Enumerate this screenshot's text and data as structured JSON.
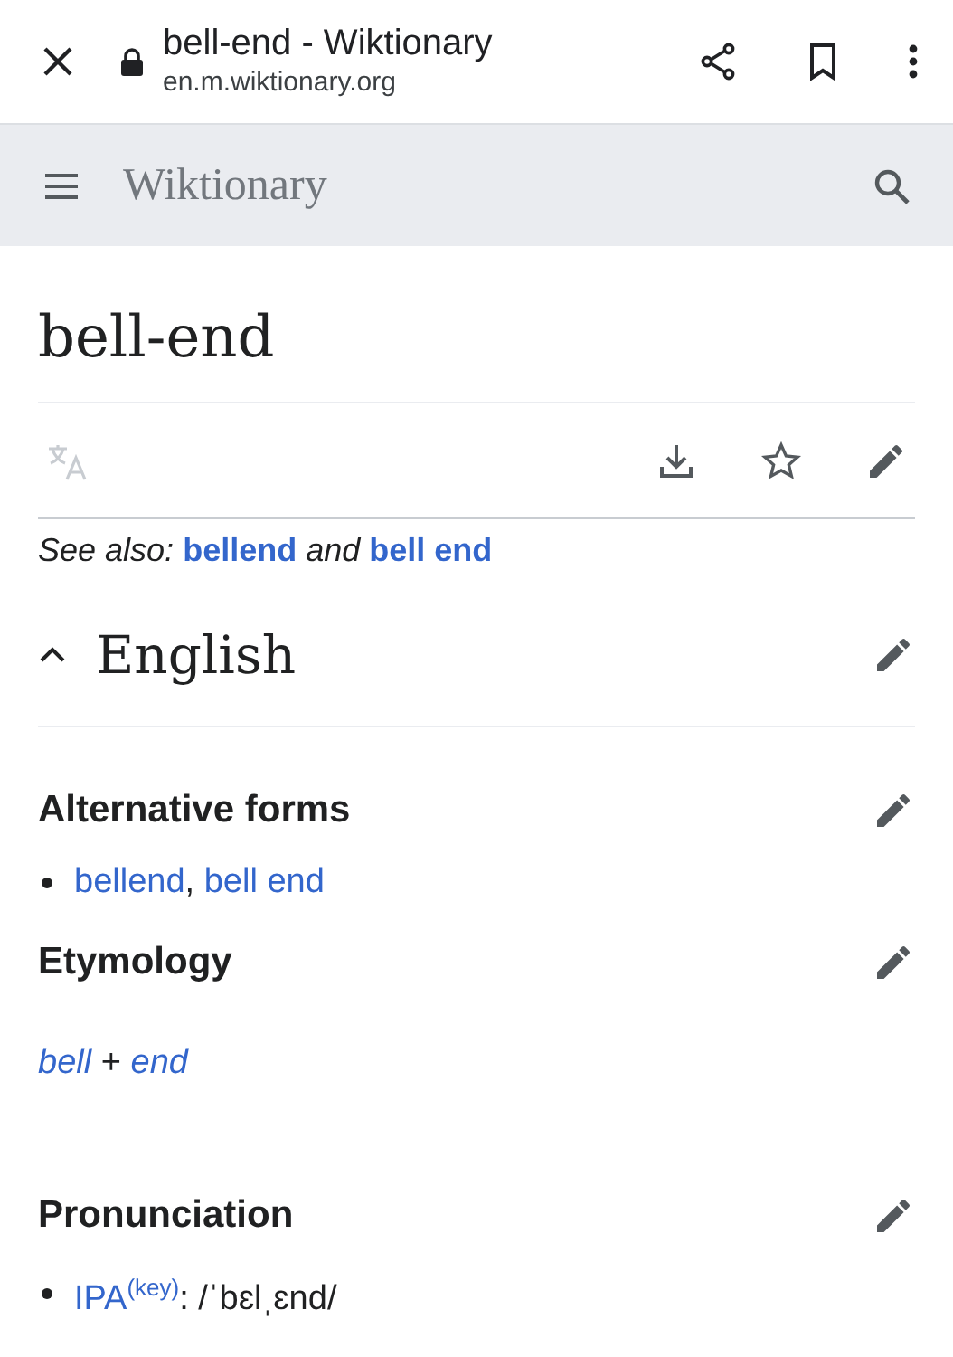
{
  "browser": {
    "title": "bell-end - Wiktionary",
    "url": "en.m.wiktionary.org"
  },
  "header": {
    "title": "Wiktionary"
  },
  "page": {
    "title": "bell-end"
  },
  "see_also": {
    "label": "See also:",
    "links": [
      "bellend",
      "bell end"
    ],
    "joiner": "and"
  },
  "language": {
    "name": "English",
    "expanded": true
  },
  "sections": [
    {
      "heading": "Alternative forms",
      "kind": "list",
      "separator": ", ",
      "links": [
        "bellend",
        "bell end"
      ]
    },
    {
      "heading": "Etymology",
      "kind": "etymology",
      "parts": [
        {
          "text": "bell",
          "link": true
        },
        {
          "text": "+",
          "link": false
        },
        {
          "text": "end",
          "link": true
        }
      ]
    },
    {
      "heading": "Pronunciation",
      "kind": "ipa",
      "label": "IPA",
      "key": "(key)",
      "value": ": /ˈbɛlˌɛnd/"
    }
  ]
}
